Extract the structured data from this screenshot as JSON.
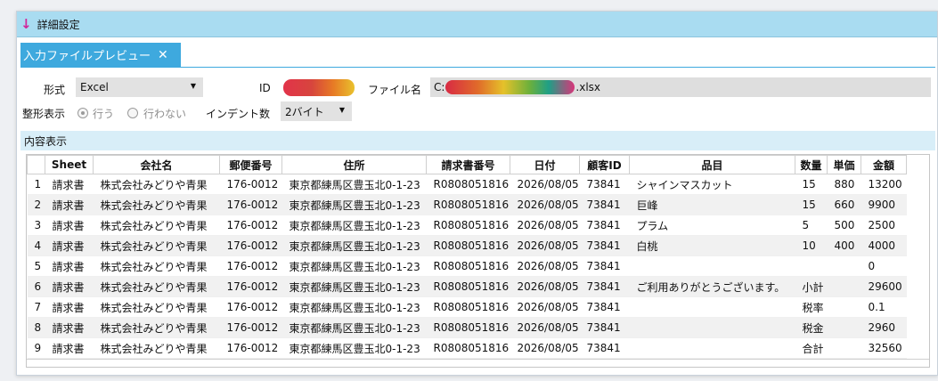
{
  "detail": {
    "arrow": "↓",
    "title": "詳細設定"
  },
  "tab": {
    "label": "入力ファイルプレビュー",
    "close": "✕"
  },
  "form": {
    "format_label": "形式",
    "format_value": "Excel",
    "id_label": "ID",
    "file_label": "ファイル名",
    "file_prefix": "C:",
    "file_suffix": ".xlsx",
    "pretty_label": "整形表示",
    "pretty_yes": "行う",
    "pretty_no": "行わない",
    "indent_label": "インデント数",
    "indent_value": "2バイト"
  },
  "content": {
    "header": "内容表示"
  },
  "table": {
    "columns": [
      "",
      "Sheet",
      "会社名",
      "郵便番号",
      "住所",
      "請求書番号",
      "日付",
      "顧客ID",
      "品目",
      "数量",
      "単価",
      "金額"
    ],
    "rows": [
      [
        "1",
        "請求書",
        "株式会社みどりや青果",
        "176-0012",
        "東京都練馬区豊玉北0-1-23",
        "R0808051816",
        "2026/08/05",
        "73841",
        "シャインマスカット",
        "15",
        "880",
        "13200"
      ],
      [
        "2",
        "請求書",
        "株式会社みどりや青果",
        "176-0012",
        "東京都練馬区豊玉北0-1-23",
        "R0808051816",
        "2026/08/05",
        "73841",
        "巨峰",
        "15",
        "660",
        "9900"
      ],
      [
        "3",
        "請求書",
        "株式会社みどりや青果",
        "176-0012",
        "東京都練馬区豊玉北0-1-23",
        "R0808051816",
        "2026/08/05",
        "73841",
        "プラム",
        "5",
        "500",
        "2500"
      ],
      [
        "4",
        "請求書",
        "株式会社みどりや青果",
        "176-0012",
        "東京都練馬区豊玉北0-1-23",
        "R0808051816",
        "2026/08/05",
        "73841",
        "白桃",
        "10",
        "400",
        "4000"
      ],
      [
        "5",
        "請求書",
        "株式会社みどりや青果",
        "176-0012",
        "東京都練馬区豊玉北0-1-23",
        "R0808051816",
        "2026/08/05",
        "73841",
        "",
        "",
        "",
        "0"
      ],
      [
        "6",
        "請求書",
        "株式会社みどりや青果",
        "176-0012",
        "東京都練馬区豊玉北0-1-23",
        "R0808051816",
        "2026/08/05",
        "73841",
        "ご利用ありがとうございます。",
        "小計",
        "",
        "29600"
      ],
      [
        "7",
        "請求書",
        "株式会社みどりや青果",
        "176-0012",
        "東京都練馬区豊玉北0-1-23",
        "R0808051816",
        "2026/08/05",
        "73841",
        "",
        "税率",
        "",
        "0.1"
      ],
      [
        "8",
        "請求書",
        "株式会社みどりや青果",
        "176-0012",
        "東京都練馬区豊玉北0-1-23",
        "R0808051816",
        "2026/08/05",
        "73841",
        "",
        "税金",
        "",
        "2960"
      ],
      [
        "9",
        "請求書",
        "株式会社みどりや青果",
        "176-0012",
        "東京都練馬区豊玉北0-1-23",
        "R0808051816",
        "2026/08/05",
        "73841",
        "",
        "合計",
        "",
        "32560"
      ]
    ]
  }
}
